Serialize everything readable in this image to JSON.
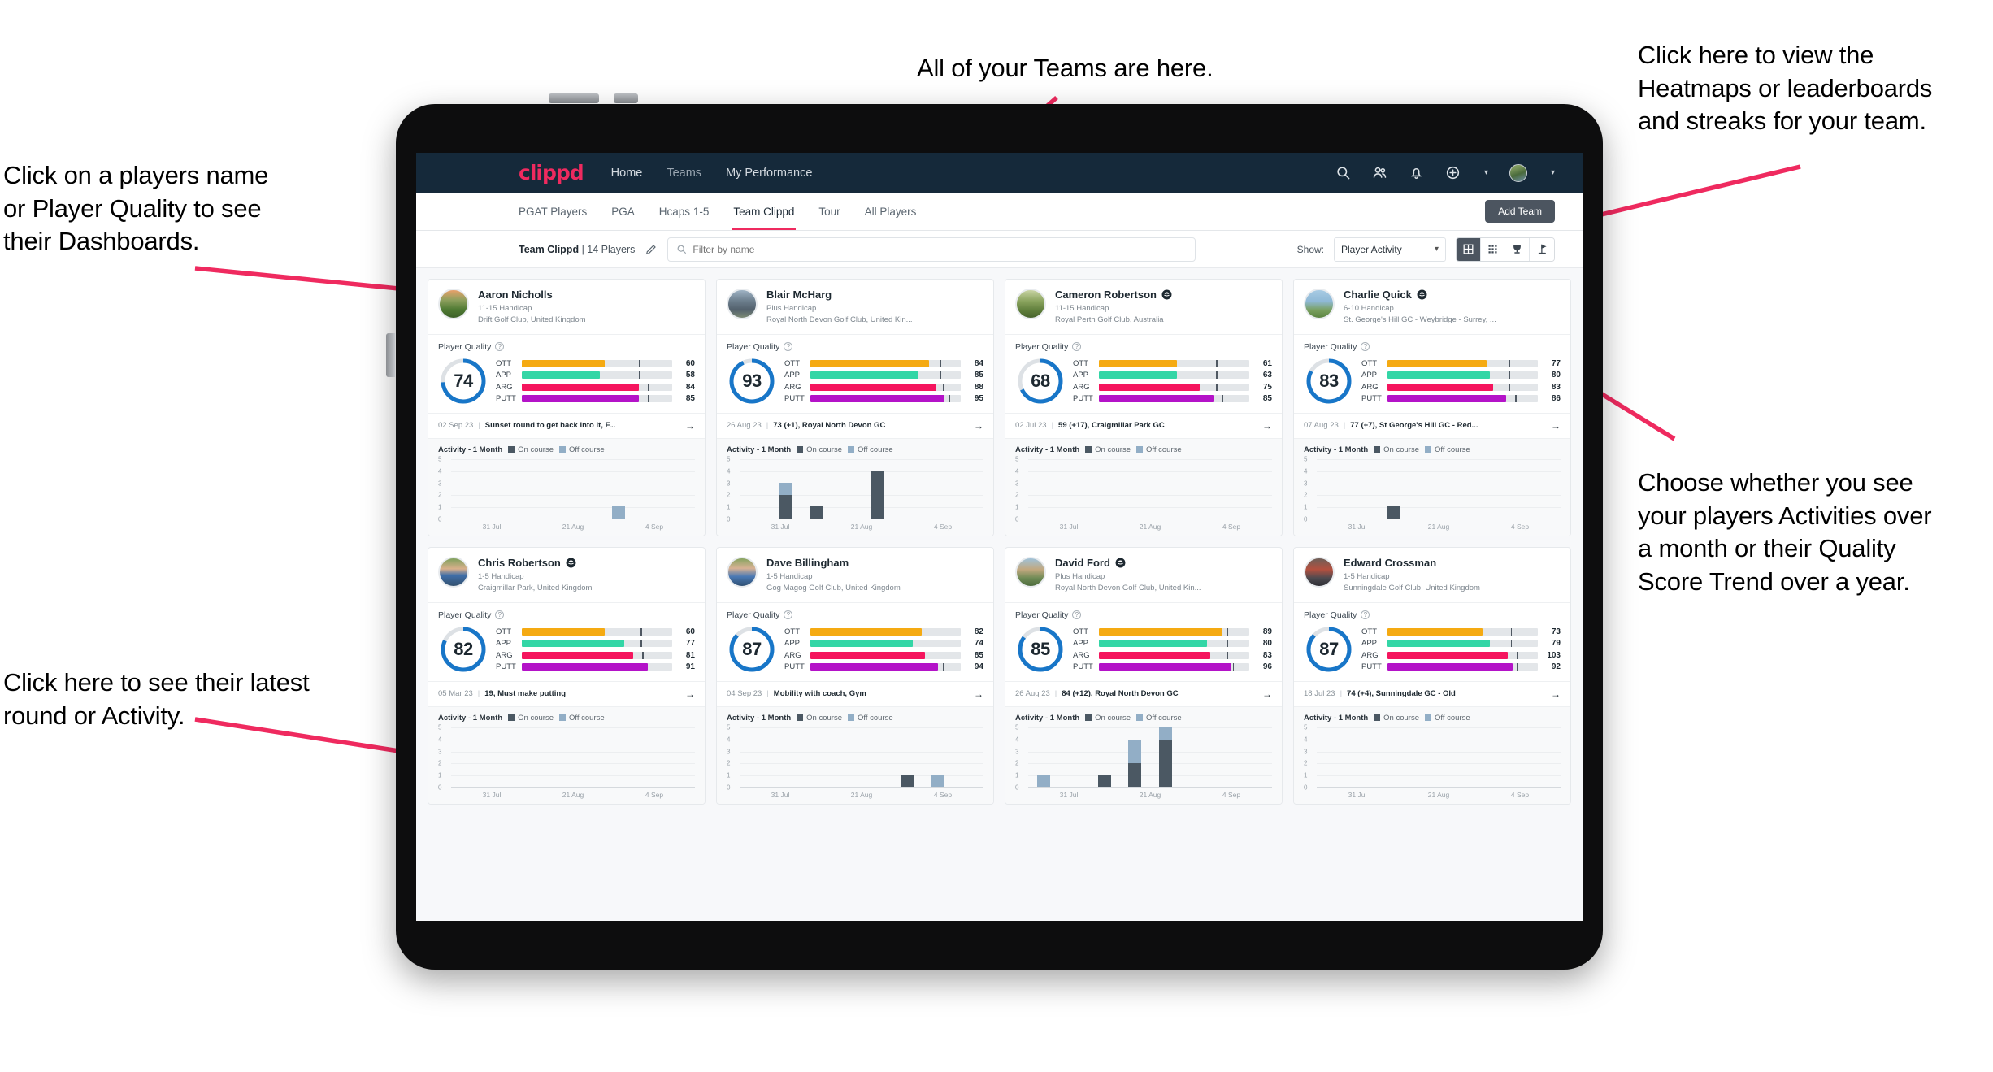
{
  "annotations": [
    {
      "id": "teams",
      "text": "All of your Teams are here."
    },
    {
      "id": "heatmaps",
      "text": "Click here to view the\nHeatmaps or leaderboards\nand streaks for your team."
    },
    {
      "id": "player-name",
      "text": "Click on a players name\nor Player Quality to see\ntheir Dashboards."
    },
    {
      "id": "activity-choice",
      "text": "Choose whether you see\nyour players Activities over\na month or their Quality\nScore Trend over a year."
    },
    {
      "id": "latest-round",
      "text": "Click here to see their latest\nround or Activity."
    }
  ],
  "topnav": {
    "brand": "clippd",
    "links": [
      "Home",
      "Teams",
      "My Performance"
    ],
    "icons": [
      "search-icon",
      "team-icon",
      "bell-icon",
      "plus-circle-icon",
      "avatar"
    ]
  },
  "tabs": {
    "items": [
      "PGAT Players",
      "PGA",
      "Hcaps 1-5",
      "Team Clippd",
      "Tour",
      "All Players"
    ],
    "active": "Team Clippd",
    "add_team_label": "Add Team"
  },
  "toolbar": {
    "team_name": "Team Clippd",
    "team_count": "| 14 Players",
    "edit_icon": "pencil-icon",
    "search_placeholder": "Filter by name",
    "search_value": "",
    "show_label": "Show:",
    "show_value": "Player Activity",
    "view_modes": [
      "grid-view-icon",
      "compact-grid-icon",
      "leaderboard-trophy-icon",
      "heatmap-flag-icon"
    ],
    "active_view": "grid-view-icon"
  },
  "card_labels": {
    "player_quality": "Player Quality",
    "help_icon": "question-circle-icon",
    "activity_title": "Activity - 1 Month",
    "legend_on": "On course",
    "legend_off": "Off course",
    "arrow_icon": "arrow-right-icon",
    "metric_names": [
      "OTT",
      "APP",
      "ARG",
      "PUTT"
    ],
    "x_ticks": [
      "31 Jul",
      "21 Aug",
      "4 Sep"
    ],
    "y_ticks": [
      "5",
      "4",
      "3",
      "2",
      "1",
      "0"
    ]
  },
  "colors": {
    "brand_pink": "#ef2a5f",
    "nav_dark": "#15293a",
    "ring_blue": "#1876c8",
    "ott": "#f5aa12",
    "app": "#33d6a6",
    "arg": "#f5155e",
    "putt": "#b413c8",
    "on_course": "#4b5863",
    "off_course": "#92aec6",
    "button_grey": "#4c5560"
  },
  "players": [
    {
      "name": "Aaron Nicholls",
      "verified": false,
      "handicap": "11-15 Handicap",
      "club": "Drift Golf Club, United Kingdom",
      "quality": 74,
      "metrics": [
        {
          "label": "OTT",
          "value": 60,
          "fill_pct": 55,
          "tick_pct": 78,
          "color": "#f5aa12"
        },
        {
          "label": "APP",
          "value": 58,
          "fill_pct": 52,
          "tick_pct": 78,
          "color": "#33d6a6"
        },
        {
          "label": "ARG",
          "value": 84,
          "fill_pct": 78,
          "tick_pct": 84,
          "color": "#f5155e"
        },
        {
          "label": "PUTT",
          "value": 85,
          "fill_pct": 78,
          "tick_pct": 84,
          "color": "#b413c8"
        }
      ],
      "round_date": "02 Sep 23",
      "round_text": "Sunset round to get back into it, F...",
      "chart_data": {
        "type": "bar",
        "ylim": [
          0,
          5
        ],
        "categories": [
          "31 Jul",
          "21 Aug",
          "4 Sep"
        ],
        "series": [
          {
            "name": "On course",
            "values": [
              0,
              0,
              0,
              0,
              0,
              0,
              0,
              0
            ]
          },
          {
            "name": "Off course",
            "values": [
              0,
              0,
              0,
              0,
              0,
              1,
              0,
              0
            ]
          }
        ]
      }
    },
    {
      "name": "Blair McHarg",
      "verified": false,
      "handicap": "Plus Handicap",
      "club": "Royal North Devon Golf Club, United Kin...",
      "quality": 93,
      "metrics": [
        {
          "label": "OTT",
          "value": 84,
          "fill_pct": 79,
          "tick_pct": 86,
          "color": "#f5aa12"
        },
        {
          "label": "APP",
          "value": 85,
          "fill_pct": 72,
          "tick_pct": 86,
          "color": "#33d6a6"
        },
        {
          "label": "ARG",
          "value": 88,
          "fill_pct": 84,
          "tick_pct": 88,
          "color": "#f5155e"
        },
        {
          "label": "PUTT",
          "value": 95,
          "fill_pct": 89,
          "tick_pct": 92,
          "color": "#b413c8"
        }
      ],
      "round_date": "26 Aug 23",
      "round_text": "73 (+1), Royal North Devon GC",
      "chart_data": {
        "type": "bar",
        "ylim": [
          0,
          5
        ],
        "categories": [
          "31 Jul",
          "21 Aug",
          "4 Sep"
        ],
        "series": [
          {
            "name": "On course",
            "values": [
              0,
              2,
              1,
              0,
              4,
              0,
              0,
              0
            ]
          },
          {
            "name": "Off course",
            "values": [
              0,
              1,
              0,
              0,
              0,
              0,
              0,
              0
            ]
          }
        ]
      }
    },
    {
      "name": "Cameron Robertson",
      "verified": true,
      "handicap": "11-15 Handicap",
      "club": "Royal Perth Golf Club, Australia",
      "quality": 68,
      "metrics": [
        {
          "label": "OTT",
          "value": 61,
          "fill_pct": 52,
          "tick_pct": 78,
          "color": "#f5aa12"
        },
        {
          "label": "APP",
          "value": 63,
          "fill_pct": 52,
          "tick_pct": 78,
          "color": "#33d6a6"
        },
        {
          "label": "ARG",
          "value": 75,
          "fill_pct": 67,
          "tick_pct": 78,
          "color": "#f5155e"
        },
        {
          "label": "PUTT",
          "value": 85,
          "fill_pct": 76,
          "tick_pct": 82,
          "color": "#b413c8"
        }
      ],
      "round_date": "02 Jul 23",
      "round_text": "59 (+17), Craigmillar Park GC",
      "chart_data": {
        "type": "bar",
        "ylim": [
          0,
          5
        ],
        "categories": [
          "31 Jul",
          "21 Aug",
          "4 Sep"
        ],
        "series": [
          {
            "name": "On course",
            "values": [
              0,
              0,
              0,
              0,
              0,
              0,
              0,
              0
            ]
          },
          {
            "name": "Off course",
            "values": [
              0,
              0,
              0,
              0,
              0,
              0,
              0,
              0
            ]
          }
        ]
      }
    },
    {
      "name": "Charlie Quick",
      "verified": true,
      "handicap": "6-10 Handicap",
      "club": "St. George's Hill GC - Weybridge - Surrey, ...",
      "quality": 83,
      "metrics": [
        {
          "label": "OTT",
          "value": 77,
          "fill_pct": 66,
          "tick_pct": 81,
          "color": "#f5aa12"
        },
        {
          "label": "APP",
          "value": 80,
          "fill_pct": 68,
          "tick_pct": 81,
          "color": "#33d6a6"
        },
        {
          "label": "ARG",
          "value": 83,
          "fill_pct": 70,
          "tick_pct": 81,
          "color": "#f5155e"
        },
        {
          "label": "PUTT",
          "value": 86,
          "fill_pct": 79,
          "tick_pct": 85,
          "color": "#b413c8"
        }
      ],
      "round_date": "07 Aug 23",
      "round_text": "77 (+7), St George's Hill GC - Red...",
      "chart_data": {
        "type": "bar",
        "ylim": [
          0,
          5
        ],
        "categories": [
          "31 Jul",
          "21 Aug",
          "4 Sep"
        ],
        "series": [
          {
            "name": "On course",
            "values": [
              0,
              0,
              1,
              0,
              0,
              0,
              0,
              0
            ]
          },
          {
            "name": "Off course",
            "values": [
              0,
              0,
              0,
              0,
              0,
              0,
              0,
              0
            ]
          }
        ]
      }
    },
    {
      "name": "Chris Robertson",
      "verified": true,
      "handicap": "1-5 Handicap",
      "club": "Craigmillar Park, United Kingdom",
      "quality": 82,
      "metrics": [
        {
          "label": "OTT",
          "value": 60,
          "fill_pct": 55,
          "tick_pct": 79,
          "color": "#f5aa12"
        },
        {
          "label": "APP",
          "value": 77,
          "fill_pct": 68,
          "tick_pct": 79,
          "color": "#33d6a6"
        },
        {
          "label": "ARG",
          "value": 81,
          "fill_pct": 74,
          "tick_pct": 80,
          "color": "#f5155e"
        },
        {
          "label": "PUTT",
          "value": 91,
          "fill_pct": 84,
          "tick_pct": 87,
          "color": "#b413c8"
        }
      ],
      "round_date": "05 Mar 23",
      "round_text": "19, Must make putting",
      "chart_data": {
        "type": "bar",
        "ylim": [
          0,
          5
        ],
        "categories": [
          "31 Jul",
          "21 Aug",
          "4 Sep"
        ],
        "series": [
          {
            "name": "On course",
            "values": [
              0,
              0,
              0,
              0,
              0,
              0,
              0,
              0
            ]
          },
          {
            "name": "Off course",
            "values": [
              0,
              0,
              0,
              0,
              0,
              0,
              0,
              0
            ]
          }
        ]
      }
    },
    {
      "name": "Dave Billingham",
      "verified": false,
      "handicap": "1-5 Handicap",
      "club": "Gog Magog Golf Club, United Kingdom",
      "quality": 87,
      "metrics": [
        {
          "label": "OTT",
          "value": 82,
          "fill_pct": 74,
          "tick_pct": 83,
          "color": "#f5aa12"
        },
        {
          "label": "APP",
          "value": 74,
          "fill_pct": 68,
          "tick_pct": 83,
          "color": "#33d6a6"
        },
        {
          "label": "ARG",
          "value": 85,
          "fill_pct": 76,
          "tick_pct": 83,
          "color": "#f5155e"
        },
        {
          "label": "PUTT",
          "value": 94,
          "fill_pct": 85,
          "tick_pct": 88,
          "color": "#b413c8"
        }
      ],
      "round_date": "04 Sep 23",
      "round_text": "Mobility with coach, Gym",
      "chart_data": {
        "type": "bar",
        "ylim": [
          0,
          5
        ],
        "categories": [
          "31 Jul",
          "21 Aug",
          "4 Sep"
        ],
        "series": [
          {
            "name": "On course",
            "values": [
              0,
              0,
              0,
              0,
              0,
              1,
              0,
              0
            ]
          },
          {
            "name": "Off course",
            "values": [
              0,
              0,
              0,
              0,
              0,
              0,
              1,
              0
            ]
          }
        ]
      }
    },
    {
      "name": "David Ford",
      "verified": true,
      "handicap": "Plus Handicap",
      "club": "Royal North Devon Golf Club, United Kin...",
      "quality": 85,
      "metrics": [
        {
          "label": "OTT",
          "value": 89,
          "fill_pct": 82,
          "tick_pct": 85,
          "color": "#f5aa12"
        },
        {
          "label": "APP",
          "value": 80,
          "fill_pct": 72,
          "tick_pct": 85,
          "color": "#33d6a6"
        },
        {
          "label": "ARG",
          "value": 83,
          "fill_pct": 74,
          "tick_pct": 85,
          "color": "#f5155e"
        },
        {
          "label": "PUTT",
          "value": 96,
          "fill_pct": 88,
          "tick_pct": 89,
          "color": "#b413c8"
        }
      ],
      "round_date": "26 Aug 23",
      "round_text": "84 (+12), Royal North Devon GC",
      "chart_data": {
        "type": "bar",
        "ylim": [
          0,
          5
        ],
        "categories": [
          "31 Jul",
          "21 Aug",
          "4 Sep"
        ],
        "series": [
          {
            "name": "On course",
            "values": [
              0,
              0,
              1,
              2,
              4,
              0,
              0,
              0
            ]
          },
          {
            "name": "Off course",
            "values": [
              1,
              0,
              0,
              2,
              1,
              0,
              0,
              0
            ]
          }
        ]
      }
    },
    {
      "name": "Edward Crossman",
      "verified": false,
      "handicap": "1-5 Handicap",
      "club": "Sunningdale Golf Club, United Kingdom",
      "quality": 87,
      "metrics": [
        {
          "label": "OTT",
          "value": 73,
          "fill_pct": 63,
          "tick_pct": 82,
          "color": "#f5aa12"
        },
        {
          "label": "APP",
          "value": 79,
          "fill_pct": 68,
          "tick_pct": 82,
          "color": "#33d6a6"
        },
        {
          "label": "ARG",
          "value": 103,
          "fill_pct": 80,
          "tick_pct": 86,
          "color": "#f5155e"
        },
        {
          "label": "PUTT",
          "value": 92,
          "fill_pct": 83,
          "tick_pct": 86,
          "color": "#b413c8"
        }
      ],
      "round_date": "18 Jul 23",
      "round_text": "74 (+4), Sunningdale GC - Old",
      "chart_data": {
        "type": "bar",
        "ylim": [
          0,
          5
        ],
        "categories": [
          "31 Jul",
          "21 Aug",
          "4 Sep"
        ],
        "series": [
          {
            "name": "On course",
            "values": [
              0,
              0,
              0,
              0,
              0,
              0,
              0,
              0
            ]
          },
          {
            "name": "Off course",
            "values": [
              0,
              0,
              0,
              0,
              0,
              0,
              0,
              0
            ]
          }
        ]
      }
    }
  ]
}
